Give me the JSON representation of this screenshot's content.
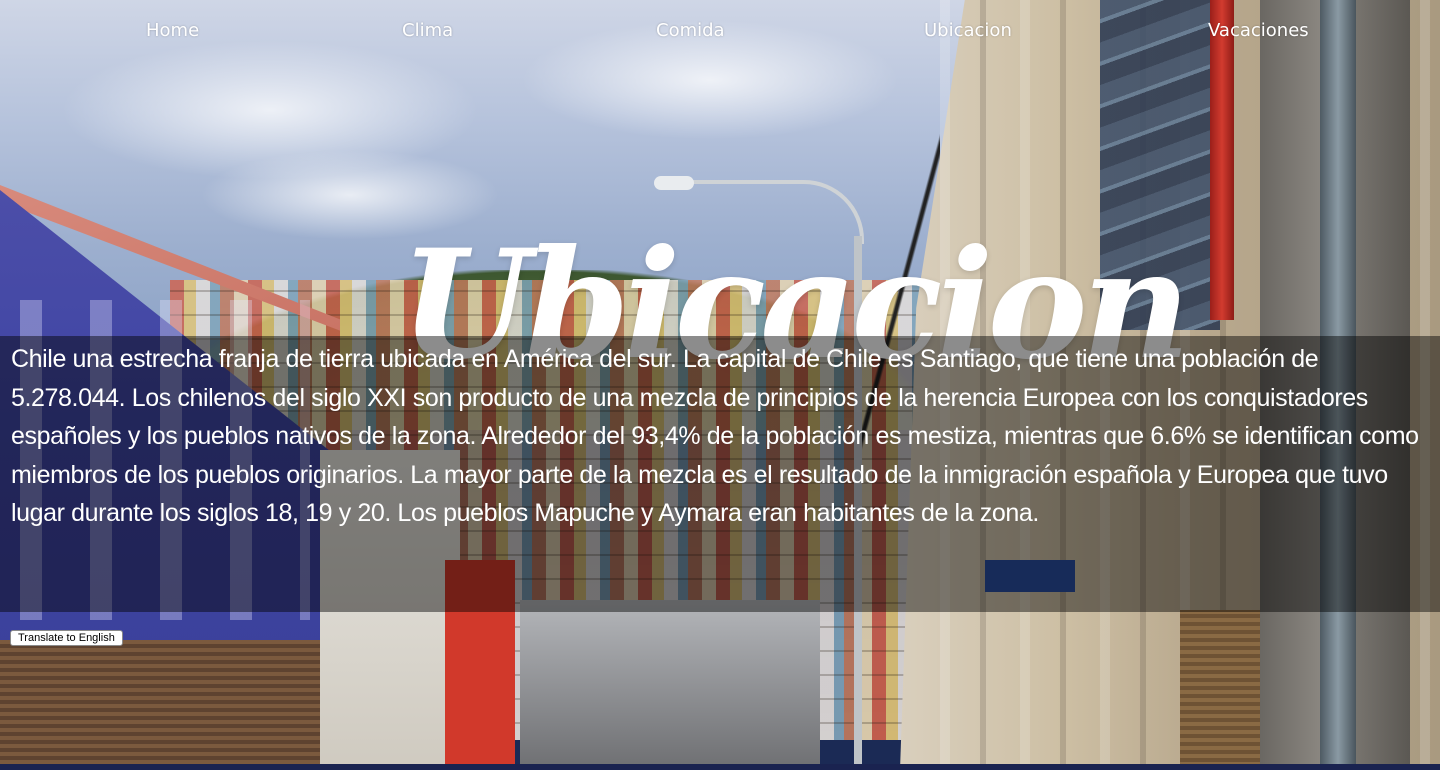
{
  "nav": {
    "items": [
      {
        "label": "Home"
      },
      {
        "label": "Clima"
      },
      {
        "label": "Comida"
      },
      {
        "label": "Ubicacion"
      },
      {
        "label": "Vacaciones"
      }
    ]
  },
  "hero": {
    "title": "Ubicacion"
  },
  "content": {
    "paragraph": "Chile una estrecha franja de tierra ubicada en América del sur. La capital de Chile es Santiago, que tiene una población de 5.278.044. Los chilenos del siglo XXI son producto de una mezcla de principios de la herencia Europea con los conquistadores españoles y los pueblos nativos de la zona. Alrededor del 93,4% de la población es mestiza, mientras que 6.6% se identifican como miembros de los pueblos originarios. La mayor parte de la mezcla es el resultado de la inmigración española y Europea que tuvo lugar durante los siglos 18, 19 y 20. Los pueblos Mapuche y Aymara eran habitantes de la zona.",
    "translate_button": "Translate to English"
  },
  "colors": {
    "text": "#ffffff",
    "panel_overlay": "rgba(0,0,0,0.45)",
    "accent_blue": "#3f45a4"
  }
}
